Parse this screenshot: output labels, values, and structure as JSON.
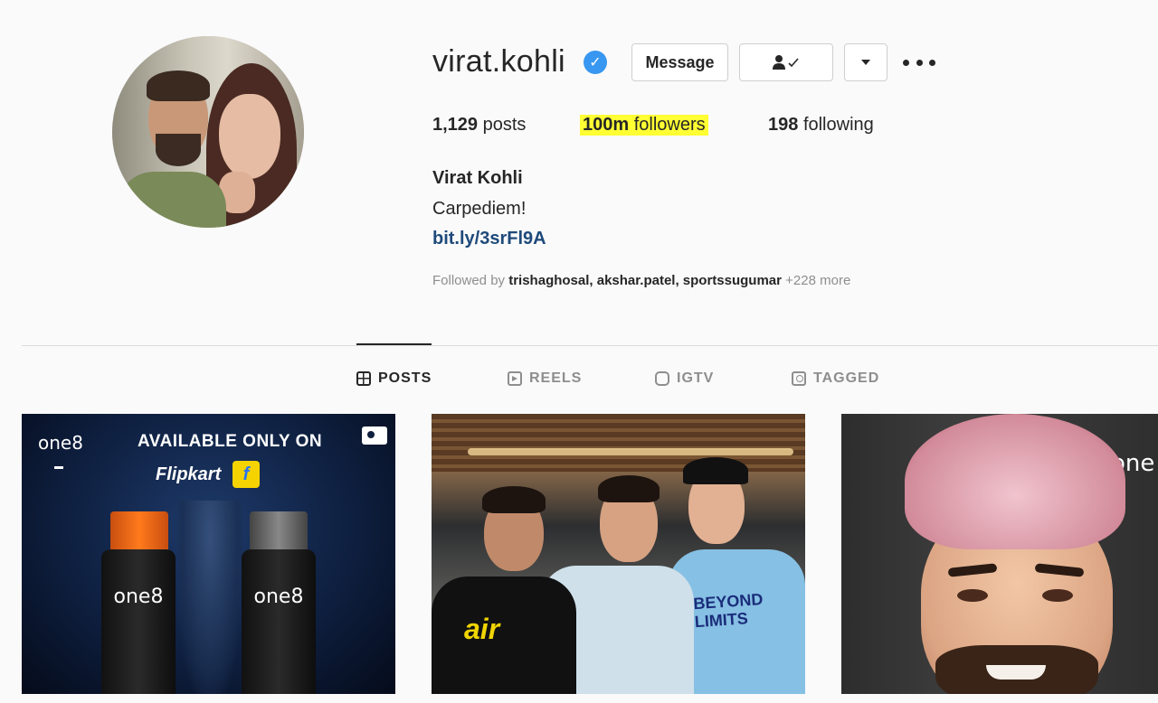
{
  "profile": {
    "username": "virat.kohli",
    "verified_icon": "verified-badge-icon",
    "buttons": {
      "message": "Message",
      "following_icon": "person-check-icon",
      "dropdown_icon": "caret-down-icon",
      "more_icon": "more-options-icon"
    },
    "stats": {
      "posts_count": "1,129",
      "posts_label": "posts",
      "followers_count": "100m",
      "followers_label": "followers",
      "following_count": "198",
      "following_label": "following"
    },
    "full_name": "Virat Kohli",
    "bio": "Carpediem!",
    "link": "bit.ly/3srFl9A",
    "followed_by": {
      "prefix": "Followed by",
      "users": "trishaghosal, akshar.patel, sportssugumar",
      "more": "+228 more"
    }
  },
  "tabs": [
    {
      "label": "POSTS",
      "icon": "grid-icon",
      "active": true
    },
    {
      "label": "REELS",
      "icon": "reels-icon",
      "active": false
    },
    {
      "label": "IGTV",
      "icon": "igtv-icon",
      "active": false
    },
    {
      "label": "TAGGED",
      "icon": "tagged-icon",
      "active": false
    }
  ],
  "posts": {
    "post1": {
      "brand_logo": "one8",
      "headline": "AVAILABLE ONLY ON",
      "store": "Flipkart",
      "store_icon_letter": "f",
      "bottle_label": "one8",
      "media_icon": "video-icon"
    },
    "post2": {
      "shirt_text_1": "air",
      "shirt_text_2": "BEYOND LIMITS"
    },
    "post3": {
      "brand_logo": "one"
    }
  },
  "colors": {
    "highlight": "#ffff33",
    "verified": "#3897f0",
    "link": "#1e4a7a",
    "background": "#fafafa"
  }
}
